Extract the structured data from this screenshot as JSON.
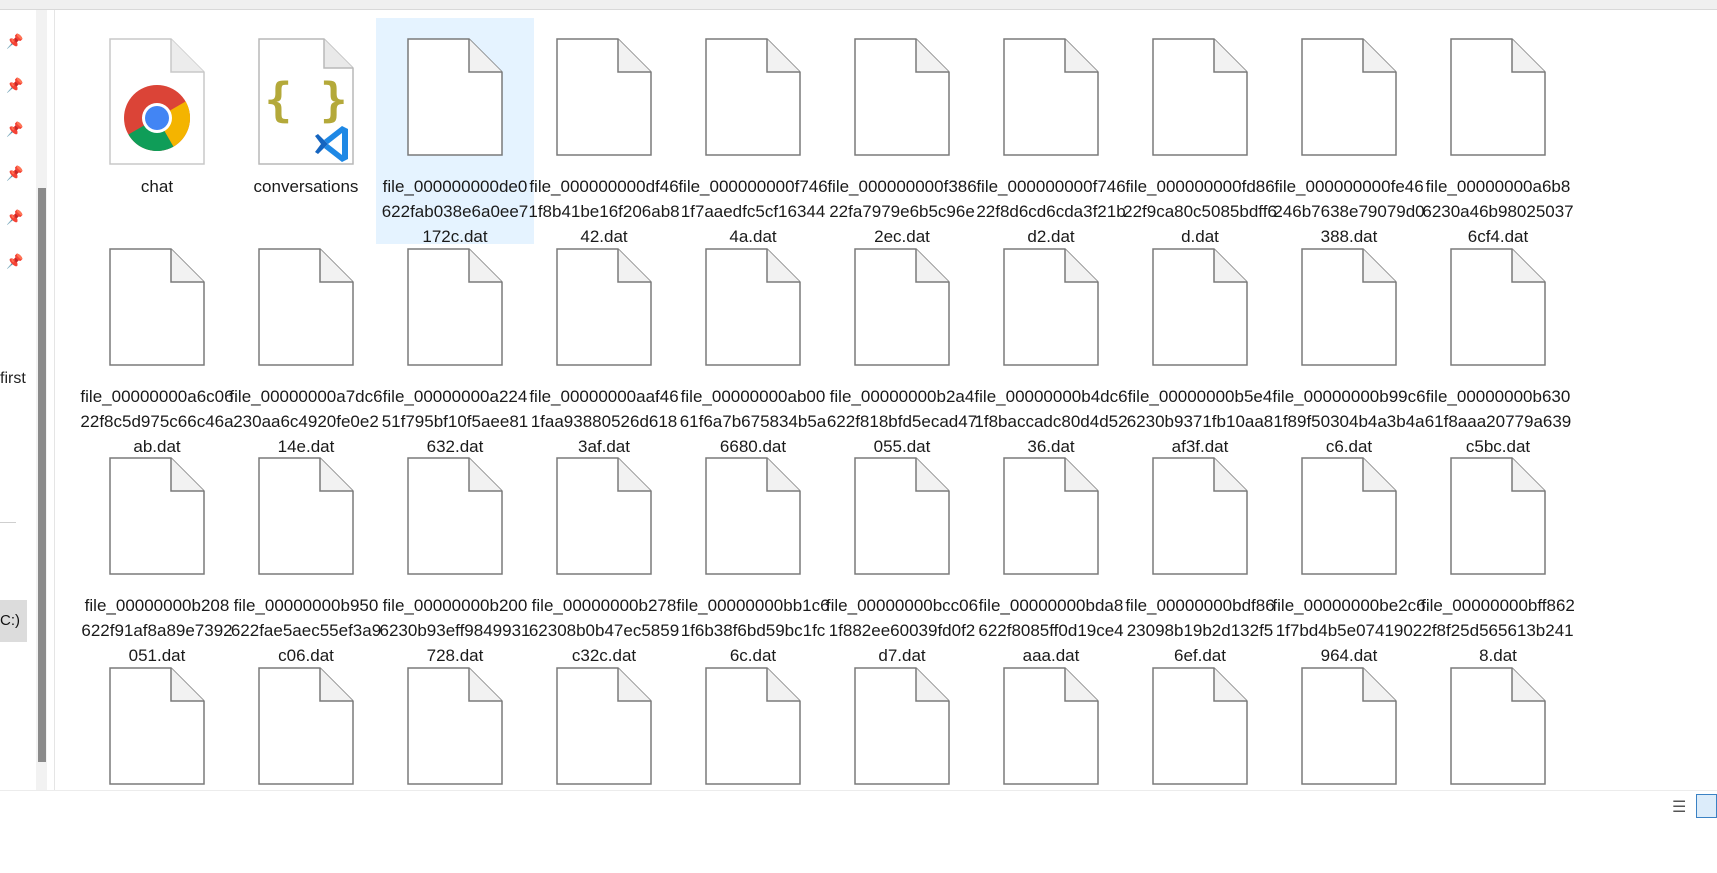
{
  "nav": {
    "partial_label": "first",
    "drive_label": "C:)",
    "pins": [
      "pin-icon",
      "pin-icon",
      "pin-icon",
      "pin-icon",
      "pin-icon",
      "pin-icon"
    ]
  },
  "files": [
    {
      "name": "chat",
      "icon": "chrome-icon"
    },
    {
      "name": "conversations",
      "icon": "json-vscode-icon"
    },
    {
      "name": "file_000000000de0622fab038e6a0ee7172c.dat",
      "icon": "blank-file-icon",
      "selected": true
    },
    {
      "name": "file_000000000df461f8b41be16f206ab842.dat",
      "icon": "blank-file-icon"
    },
    {
      "name": "file_000000000f7461f7aaedfc5cf163444a.dat",
      "icon": "blank-file-icon"
    },
    {
      "name": "file_000000000f38622fa7979e6b5c96e2ec.dat",
      "icon": "blank-file-icon"
    },
    {
      "name": "file_000000000f74622f8d6cd6cda3f21bd2.dat",
      "icon": "blank-file-icon"
    },
    {
      "name": "file_000000000fd8622f9ca80c5085bdff6d.dat",
      "icon": "blank-file-icon"
    },
    {
      "name": "file_000000000fe46246b7638e79079d0388.dat",
      "icon": "blank-file-icon"
    },
    {
      "name": "file_00000000a6b86230a46b980250376cf4.dat",
      "icon": "blank-file-icon"
    },
    {
      "name": "file_00000000a6c0622f8c5d975c66c46aab.dat",
      "icon": "blank-file-icon"
    },
    {
      "name": "file_00000000a7dc6230aa6c4920fe0e214e.dat",
      "icon": "blank-file-icon"
    },
    {
      "name": "file_00000000a22451f795bf10f5aee81632.dat",
      "icon": "blank-file-icon"
    },
    {
      "name": "file_00000000aaf461faa93880526d6183af.dat",
      "icon": "blank-file-icon"
    },
    {
      "name": "file_00000000ab0061f6a7b675834b5a6680.dat",
      "icon": "blank-file-icon"
    },
    {
      "name": "file_00000000b2a4622f818bfd5ecad47055.dat",
      "icon": "blank-file-icon"
    },
    {
      "name": "file_00000000b4dc61f8baccadc80d4d5236.dat",
      "icon": "blank-file-icon"
    },
    {
      "name": "file_00000000b5e46230b9371fb10aa8af3f.dat",
      "icon": "blank-file-icon"
    },
    {
      "name": "file_00000000b99c61f89f50304b4a3b4ac6.dat",
      "icon": "blank-file-icon"
    },
    {
      "name": "file_00000000b63061f8aaa20779a639c5bc.dat",
      "icon": "blank-file-icon"
    },
    {
      "name": "file_00000000b208622f91af8a89e7392051.dat",
      "icon": "blank-file-icon"
    },
    {
      "name": "file_00000000b950622fae5aec55ef3a9c06.dat",
      "icon": "blank-file-icon"
    },
    {
      "name": "file_00000000b2006230b93eff9849931728.dat",
      "icon": "blank-file-icon"
    },
    {
      "name": "file_00000000b27862308b0b47ec5859c32c.dat",
      "icon": "blank-file-icon"
    },
    {
      "name": "file_00000000bb1c61f6b38f6bd59bc1fc6c.dat",
      "icon": "blank-file-icon"
    },
    {
      "name": "file_00000000bcc061f882ee60039fd0f2d7.dat",
      "icon": "blank-file-icon"
    },
    {
      "name": "file_00000000bda8622f8085ff0d19ce4aaa.dat",
      "icon": "blank-file-icon"
    },
    {
      "name": "file_00000000bdf8623098b19b2d132f56ef.dat",
      "icon": "blank-file-icon"
    },
    {
      "name": "file_00000000be2c61f7bd4b5e0741902964.dat",
      "icon": "blank-file-icon"
    },
    {
      "name": "file_00000000bff8622f8f25d565613b2418.dat",
      "icon": "blank-file-icon"
    },
    {
      "name": "",
      "icon": "blank-file-icon"
    },
    {
      "name": "",
      "icon": "blank-file-icon"
    },
    {
      "name": "",
      "icon": "blank-file-icon"
    },
    {
      "name": "",
      "icon": "blank-file-icon"
    },
    {
      "name": "",
      "icon": "blank-file-icon"
    },
    {
      "name": "",
      "icon": "blank-file-icon"
    },
    {
      "name": "",
      "icon": "blank-file-icon"
    },
    {
      "name": "",
      "icon": "blank-file-icon"
    },
    {
      "name": "",
      "icon": "blank-file-icon"
    },
    {
      "name": "",
      "icon": "blank-file-icon"
    }
  ],
  "colors": {
    "selection": "#e5f3ff",
    "accent": "#3b82c4"
  }
}
